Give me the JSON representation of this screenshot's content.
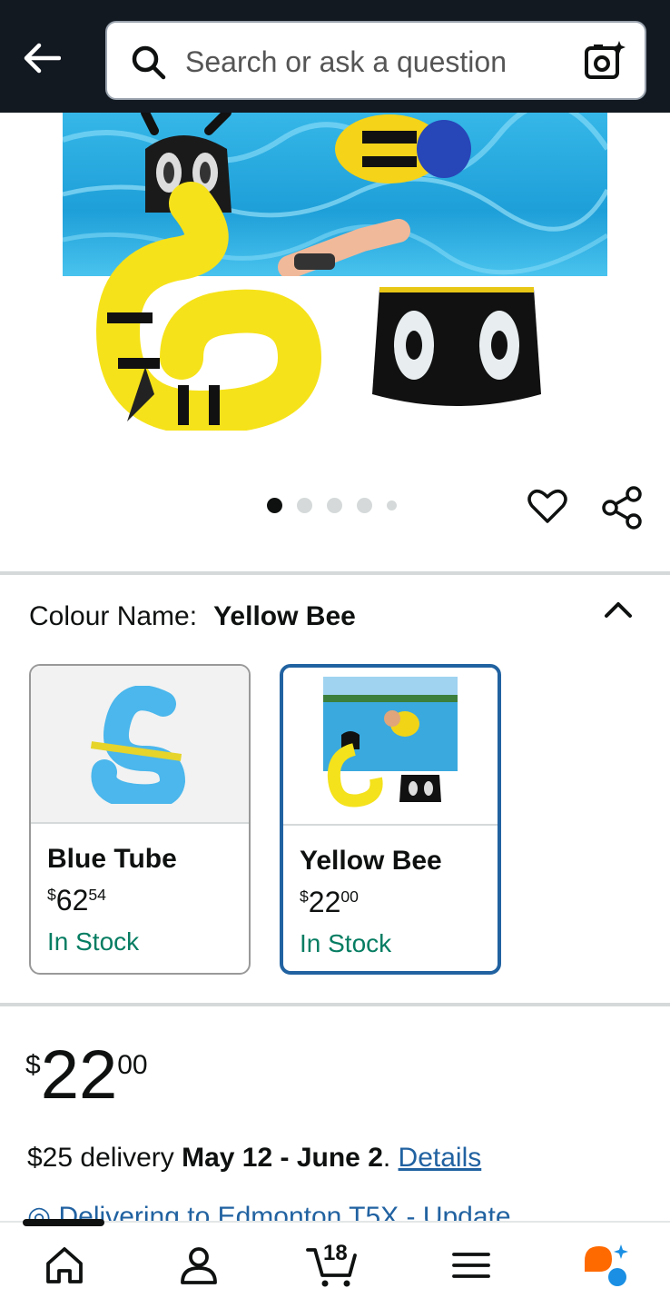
{
  "header": {
    "search_placeholder": "Search or ask a question"
  },
  "gallery": {
    "dots_total": 5,
    "active_dot": 1
  },
  "colour": {
    "label": "Colour Name:",
    "selected": "Yellow Bee"
  },
  "variants": [
    {
      "name": "Blue Tube",
      "price_symbol": "$",
      "price_whole": "62",
      "price_fraction": "54",
      "stock": "In Stock",
      "selected": false
    },
    {
      "name": "Yellow Bee",
      "price_symbol": "$",
      "price_whole": "22",
      "price_fraction": "00",
      "stock": "In Stock",
      "selected": true
    }
  ],
  "price": {
    "symbol": "$",
    "whole": "22",
    "fraction": "00"
  },
  "delivery": {
    "text": "$25 delivery ",
    "dates": "May 12 - June 2",
    "suffix": ". ",
    "details_link": "Details"
  },
  "deliver_to": {
    "text": "Delivering to Edmonton T5X - Update"
  },
  "bottom_nav": {
    "cart_count": "18"
  },
  "colors": {
    "topbar": "#131921",
    "link": "#2162a1",
    "in_stock": "#067d62",
    "selected_border": "#2162a1"
  }
}
